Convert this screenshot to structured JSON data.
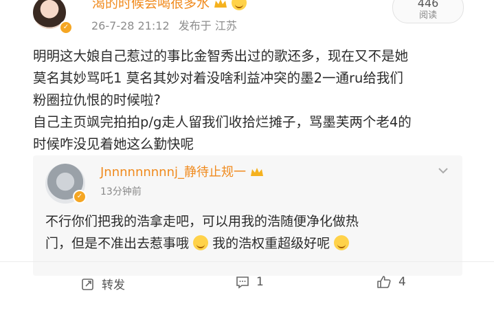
{
  "post": {
    "author_name": "渴的时候会喝很多水",
    "timestamp": "26-7-28 21:12",
    "location": "发布于 江苏",
    "reads": {
      "count": "446",
      "label": "阅读"
    },
    "lines": [
      "明明这大娘自己惹过的事比金智秀出过的歌还多，现在又不是她",
      "莫名其妙骂吒1 莫名其妙对着没啥利益冲突的墨2一通ru给我们",
      "粉圈拉仇恨的时候啦?",
      "自己主页飒完拍拍p/g走人留我们收拾烂摊子，骂墨芙两个老4的",
      "时候咋没见着她这么勤快呢"
    ]
  },
  "reply": {
    "author_name": "Jnnnnnnnnnj_静待止规一",
    "time": "13分钟前",
    "line1": "不行你们把我的浩拿走吧，可以用我的浩随便净化做热",
    "line2a": "门，但是不准出去惹事哦",
    "line2b": "我的浩权重超级好呢"
  },
  "actions": {
    "repost_label": "转发",
    "comment_count": "1",
    "like_count": "4"
  },
  "colors": {
    "accent": "#f08a1d",
    "badge": "#f5a623",
    "muted": "#8c8c8c"
  },
  "icons": [
    "crown-icon",
    "laugh-emoji-icon",
    "verified-badge-icon",
    "repost-icon",
    "comment-icon",
    "like-icon",
    "more-icon"
  ]
}
